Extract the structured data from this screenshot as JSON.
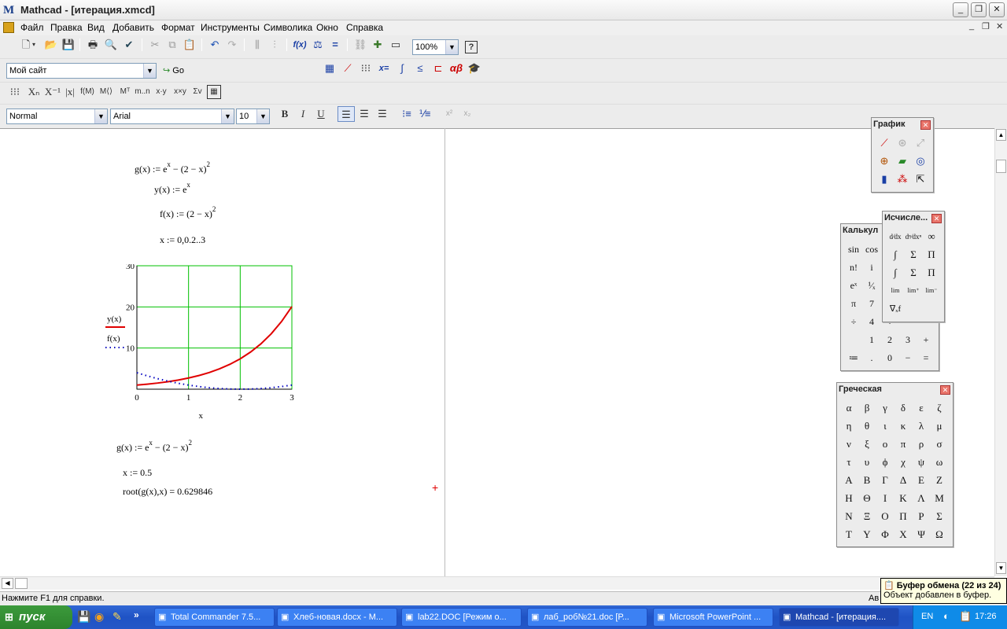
{
  "window": {
    "title": "Mathcad - [итерация.xmcd]"
  },
  "menu": [
    "Файл",
    "Правка",
    "Вид",
    "Добавить",
    "Формат",
    "Инструменты",
    "Символика",
    "Окно",
    "Справка"
  ],
  "toolbar": {
    "zoom": "100%",
    "url": "Мой сайт",
    "go": "Go"
  },
  "format_bar": {
    "style": "Normal",
    "font": "Arial",
    "size": "10",
    "bold": "B",
    "italic": "I",
    "underline": "U"
  },
  "worksheet": {
    "g_def": "g(x) := e",
    "g_rest": " − (2 − x)",
    "y_def": "y(x) := e",
    "f_def": "f(x) := (2 − x)",
    "range": "x := 0,0.2..3",
    "g_def2": "g(x) := e",
    "g_rest2": " − (2 − x)",
    "x_guess": "x := 0.5",
    "root_expr": "root(g(x),x) = 0.629846",
    "sup_x": "x",
    "sup_2": "2"
  },
  "chart_data": {
    "type": "line",
    "xlabel": "x",
    "legend": [
      "y(x)",
      "f(x)"
    ],
    "xlim": [
      0,
      3
    ],
    "ylim": [
      0,
      30
    ],
    "xticks": [
      "0",
      "1",
      "2",
      "3"
    ],
    "yticks": [
      "10",
      "20",
      "30"
    ],
    "series": [
      {
        "name": "y(x)",
        "color": "#e00000",
        "style": "solid",
        "x": [
          0,
          0.2,
          0.4,
          0.6,
          0.8,
          1.0,
          1.2,
          1.4,
          1.6,
          1.8,
          2.0,
          2.2,
          2.4,
          2.6,
          2.8,
          3.0
        ],
        "y": [
          1,
          1.221,
          1.492,
          1.822,
          2.226,
          2.718,
          3.32,
          4.055,
          4.953,
          6.05,
          7.389,
          9.025,
          11.023,
          13.464,
          16.445,
          20.086
        ]
      },
      {
        "name": "f(x)",
        "color": "#0000c0",
        "style": "dotted",
        "x": [
          0,
          0.2,
          0.4,
          0.6,
          0.8,
          1.0,
          1.2,
          1.4,
          1.6,
          1.8,
          2.0,
          2.2,
          2.4,
          2.6,
          2.8,
          3.0
        ],
        "y": [
          4,
          3.24,
          2.56,
          1.96,
          1.44,
          1.0,
          0.64,
          0.36,
          0.16,
          0.04,
          0,
          0.04,
          0.16,
          0.36,
          0.64,
          1.0
        ]
      }
    ]
  },
  "palettes": {
    "graph": {
      "title": "График"
    },
    "calculus": {
      "title": "Исчисле..."
    },
    "calculator": {
      "title": "Калькул",
      "keys": [
        "sin",
        "cos",
        "n!",
        "i",
        "eˣ",
        "¹⁄ₓ",
        "π",
        "7",
        "÷",
        "4",
        "÷",
        "1",
        "2",
        "3",
        "+",
        "≔",
        ".",
        "0",
        "−",
        "="
      ]
    },
    "greek": {
      "title": "Греческая",
      "keys": [
        "α",
        "β",
        "γ",
        "δ",
        "ε",
        "ζ",
        "η",
        "θ",
        "ι",
        "κ",
        "λ",
        "μ",
        "ν",
        "ξ",
        "ο",
        "π",
        "ρ",
        "σ",
        "τ",
        "υ",
        "ϕ",
        "χ",
        "ψ",
        "ω",
        "Α",
        "Β",
        "Γ",
        "Δ",
        "Ε",
        "Ζ",
        "Η",
        "Θ",
        "Ι",
        "Κ",
        "Λ",
        "Μ",
        "Ν",
        "Ξ",
        "Ο",
        "Π",
        "Ρ",
        "Σ",
        "Τ",
        "Υ",
        "Φ",
        "Χ",
        "Ψ",
        "Ω"
      ]
    }
  },
  "status": {
    "help": "Нажмите F1 для справки.",
    "right": "Ав"
  },
  "tooltip": {
    "title": "Буфер обмена (22 из 24)",
    "text": "Объект добавлен в буфер."
  },
  "taskbar": {
    "start": "пуск",
    "tasks": [
      "Total Commander 7.5...",
      "Хлеб-новая.docx - M...",
      "lab22.DOC [Режим о...",
      "лаб_роб№21.doc [Р...",
      "Microsoft PowerPoint ...",
      "Mathcad - [итерация...."
    ],
    "lang": "EN",
    "clock": "17:26"
  }
}
